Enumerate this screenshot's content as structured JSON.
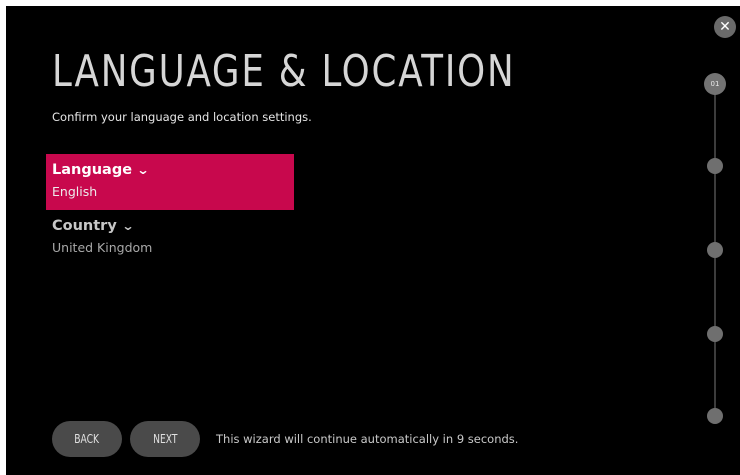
{
  "page": {
    "title": "LANGUAGE & LOCATION",
    "subtitle": "Confirm your language and location settings."
  },
  "settings": [
    {
      "label": "Language",
      "value": "English",
      "active": true
    },
    {
      "label": "Country",
      "value": "United Kingdom",
      "active": false
    }
  ],
  "footer": {
    "back_label": "BACK",
    "next_label": "NEXT",
    "countdown_text": "This wizard will continue automatically in 9 seconds."
  },
  "progress": {
    "current_step_label": "01",
    "total_steps": 5,
    "current_step": 1
  },
  "icons": {
    "close": "close-icon",
    "chevron": "chevron-down-icon"
  },
  "colors": {
    "accent": "#c8084d",
    "background": "#000000",
    "button": "#4a4a4a"
  }
}
